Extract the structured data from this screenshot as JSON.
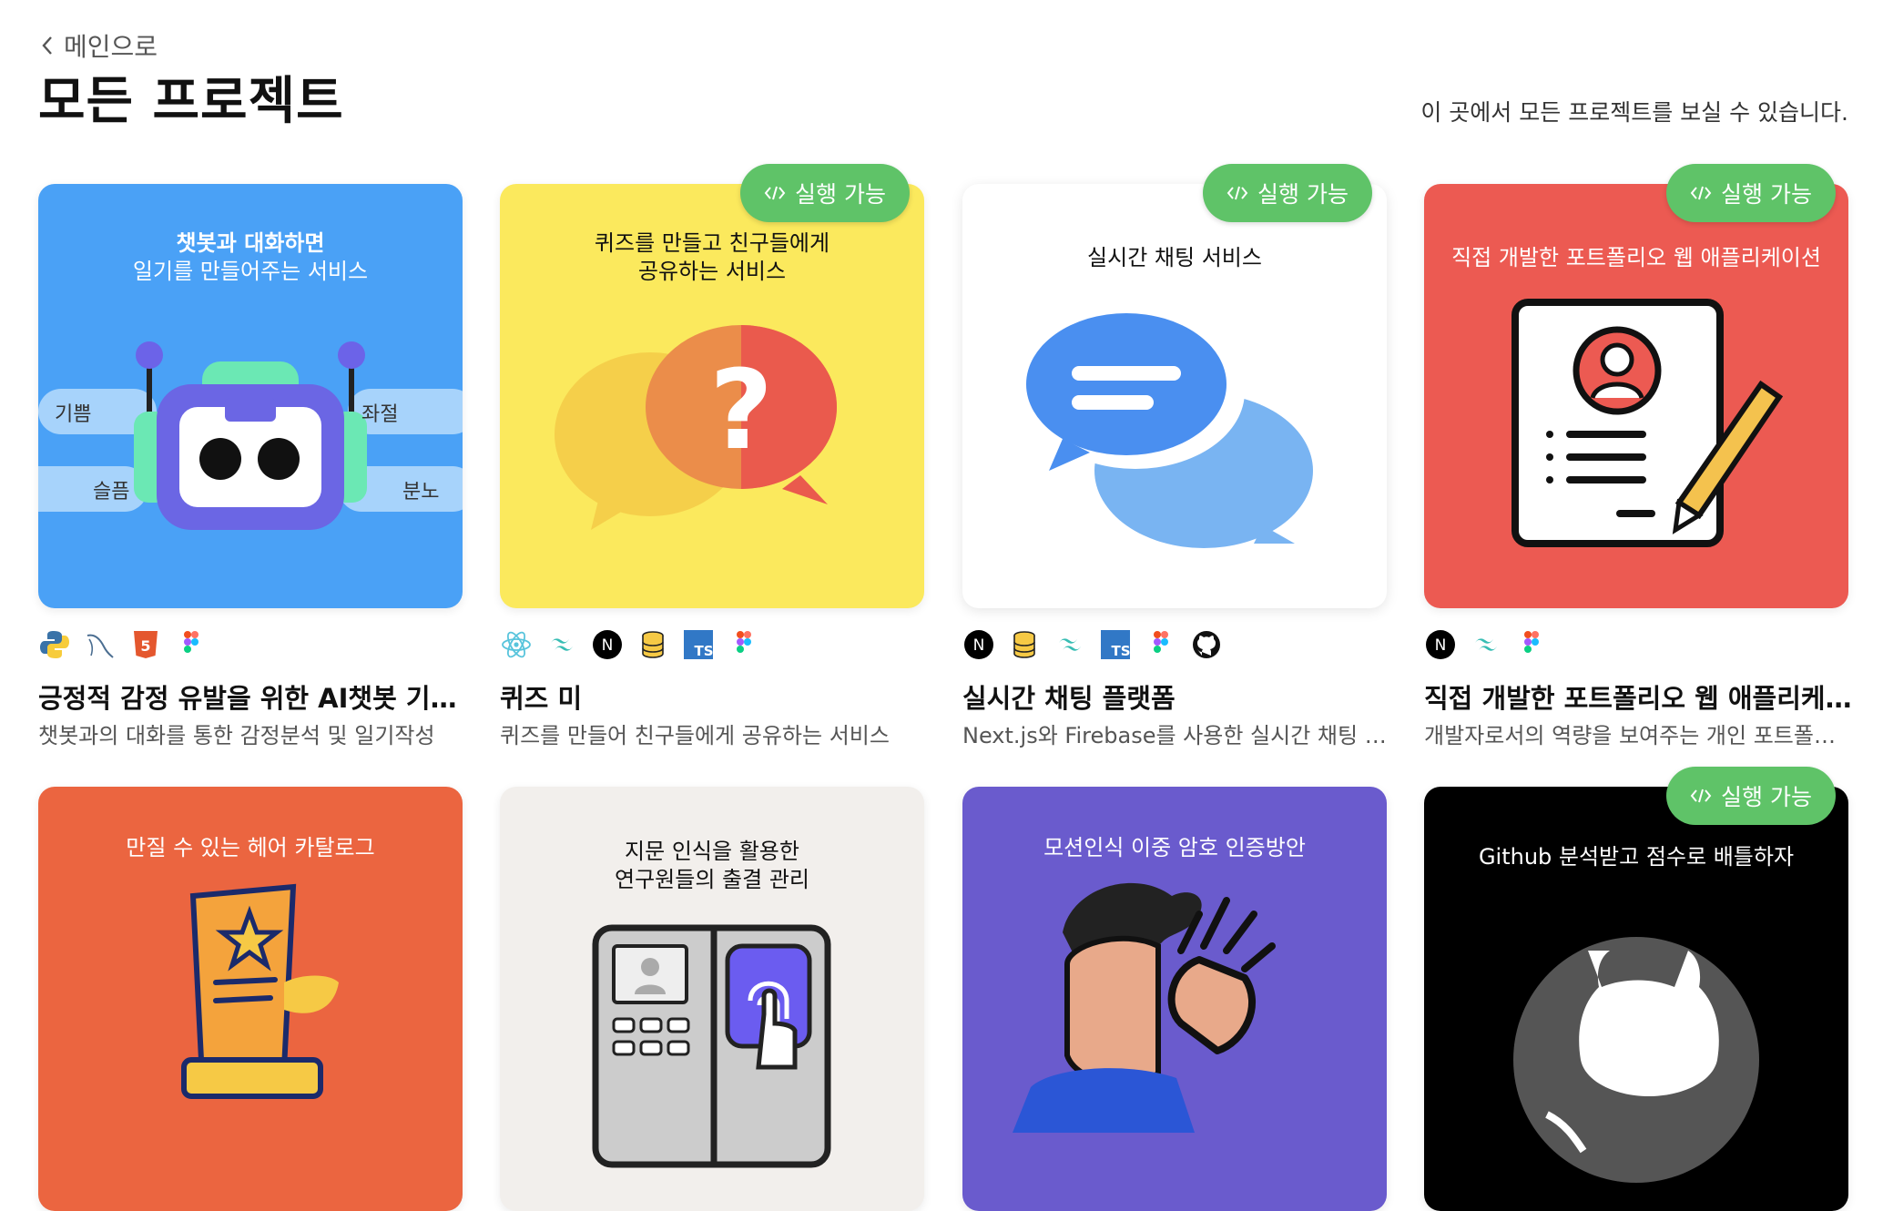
{
  "nav": {
    "back_label": "메인으로"
  },
  "page": {
    "title": "모든 프로젝트",
    "subtitle": "이 곳에서 모든 프로젝트를 보실 수 있습니다."
  },
  "badge_label": "실행 가능",
  "colors": {
    "badge": "#5fc368",
    "blue": "#4aa1f6",
    "yellow": "#fbe95d",
    "red": "#ec5a52",
    "orange": "#eb6540",
    "beige": "#f2efec",
    "purple": "#6a5bcd",
    "black": "#000000"
  },
  "projects": [
    {
      "name": "긍정적 감정 유발을 위한 AI챗봇 기반 …",
      "desc": "챗봇과의 대화를 통한 감정분석 및 일기작성",
      "runnable": false,
      "card_line1": "챗봇과 대화하면",
      "card_line2": "일기를 만들어주는 서비스",
      "tags": {
        "t1": "기쁨",
        "t2": "좌절",
        "t3": "슬픔",
        "t4": "분노"
      },
      "stack": [
        "python-icon",
        "mysql-icon",
        "html5-icon",
        "figma-icon"
      ]
    },
    {
      "name": "퀴즈 미",
      "desc": "퀴즈를 만들어 친구들에게 공유하는 서비스",
      "runnable": true,
      "card_line1": "퀴즈를 만들고 친구들에게",
      "card_line2": "공유하는 서비스",
      "stack": [
        "react-icon",
        "tailwind-icon",
        "nextjs-icon",
        "database-icon",
        "typescript-icon",
        "figma-icon"
      ]
    },
    {
      "name": "실시간 채팅 플랫폼",
      "desc": "Next.js와 Firebase를 사용한 실시간 채팅 …",
      "runnable": true,
      "card_line1": "실시간 채팅 서비스",
      "stack": [
        "nextjs-icon",
        "database-icon",
        "tailwind-icon",
        "typescript-icon",
        "figma-icon",
        "github-icon"
      ]
    },
    {
      "name": "직접 개발한 포트폴리오 웹 애플리케…",
      "desc": "개발자로서의 역량을 보여주는 개인 포트폴…",
      "runnable": true,
      "card_line1": "직접 개발한 포트폴리오 웹 애플리케이션",
      "stack": [
        "nextjs-icon",
        "tailwind-icon",
        "figma-icon"
      ]
    },
    {
      "runnable": false,
      "card_line1": "만질 수 있는 헤어 카탈로그"
    },
    {
      "runnable": false,
      "card_line1": "지문 인식을 활용한",
      "card_line2": "연구원들의 출결 관리"
    },
    {
      "runnable": false,
      "card_line1": "모션인식 이중 암호 인증방안"
    },
    {
      "runnable": true,
      "card_line1": "Github 분석받고 점수로 배틀하자"
    }
  ]
}
